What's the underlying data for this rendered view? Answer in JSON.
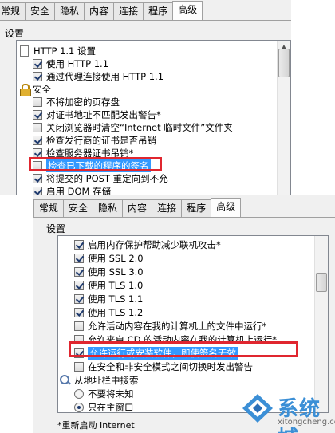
{
  "top_dialog": {
    "tabs": [
      "常规",
      "安全",
      "隐私",
      "内容",
      "连接",
      "程序",
      "高级"
    ],
    "active_tab": "高级",
    "section_label": "设置",
    "items": [
      {
        "kind": "folder",
        "text": "HTTP 1.1 设置"
      },
      {
        "kind": "check",
        "checked": true,
        "text": "使用 HTTP 1.1"
      },
      {
        "kind": "check",
        "checked": true,
        "text": "通过代理连接使用 HTTP 1.1"
      },
      {
        "kind": "group",
        "text": "安全"
      },
      {
        "kind": "check",
        "checked": false,
        "text": "不将加密的页存盘"
      },
      {
        "kind": "check",
        "checked": true,
        "text": "对证书地址不匹配发出警告*"
      },
      {
        "kind": "check",
        "checked": false,
        "text": "关闭浏览器时清空“Internet 临时文件”文件夹"
      },
      {
        "kind": "check",
        "checked": true,
        "text": "检查发行商的证书是否吊销"
      },
      {
        "kind": "check",
        "checked": true,
        "text": "检查服务器证书吊销*"
      },
      {
        "kind": "check",
        "checked": false,
        "text": "检查已下载的程序的签名",
        "selected": true
      },
      {
        "kind": "check",
        "checked": true,
        "text": "将提交的 POST 重定向到不允"
      },
      {
        "kind": "check",
        "checked": true,
        "text": "启用 DOM 存储"
      }
    ]
  },
  "bottom_dialog": {
    "tabs": [
      "常规",
      "安全",
      "隐私",
      "内容",
      "连接",
      "程序",
      "高级"
    ],
    "active_tab": "高级",
    "section_label": "设置",
    "items": [
      {
        "kind": "check",
        "checked": true,
        "text": "启用内存保护帮助减少联机攻击*"
      },
      {
        "kind": "check",
        "checked": true,
        "text": "使用 SSL 2.0"
      },
      {
        "kind": "check",
        "checked": true,
        "text": "使用 SSL 3.0"
      },
      {
        "kind": "check",
        "checked": true,
        "text": "使用 TLS 1.0"
      },
      {
        "kind": "check",
        "checked": true,
        "text": "使用 TLS 1.1"
      },
      {
        "kind": "check",
        "checked": true,
        "text": "使用 TLS 1.2"
      },
      {
        "kind": "check",
        "checked": false,
        "text": "允许活动内容在我的计算机上的文件中运行*"
      },
      {
        "kind": "check",
        "checked": false,
        "text": "允许来自 CD 的活动内容在我的计算机上运行*"
      },
      {
        "kind": "check",
        "checked": true,
        "text": "允许运行或安装软件，即使签名无效",
        "selected": true
      },
      {
        "kind": "check",
        "checked": false,
        "text": "在安全和非安全模式之间切换时发出警告"
      },
      {
        "kind": "search",
        "text": "从地址栏中搜索"
      },
      {
        "kind": "radio",
        "checked": false,
        "text": "不要将未知"
      },
      {
        "kind": "radio",
        "checked": true,
        "text": "只在主窗口"
      }
    ],
    "footer_note": "*重新启动 Internet"
  },
  "watermark": {
    "brand": "系统城",
    "url": "xitongcheng.com",
    "colors": {
      "primary": "#3b8fd6",
      "accent": "#2a6fb8"
    }
  }
}
